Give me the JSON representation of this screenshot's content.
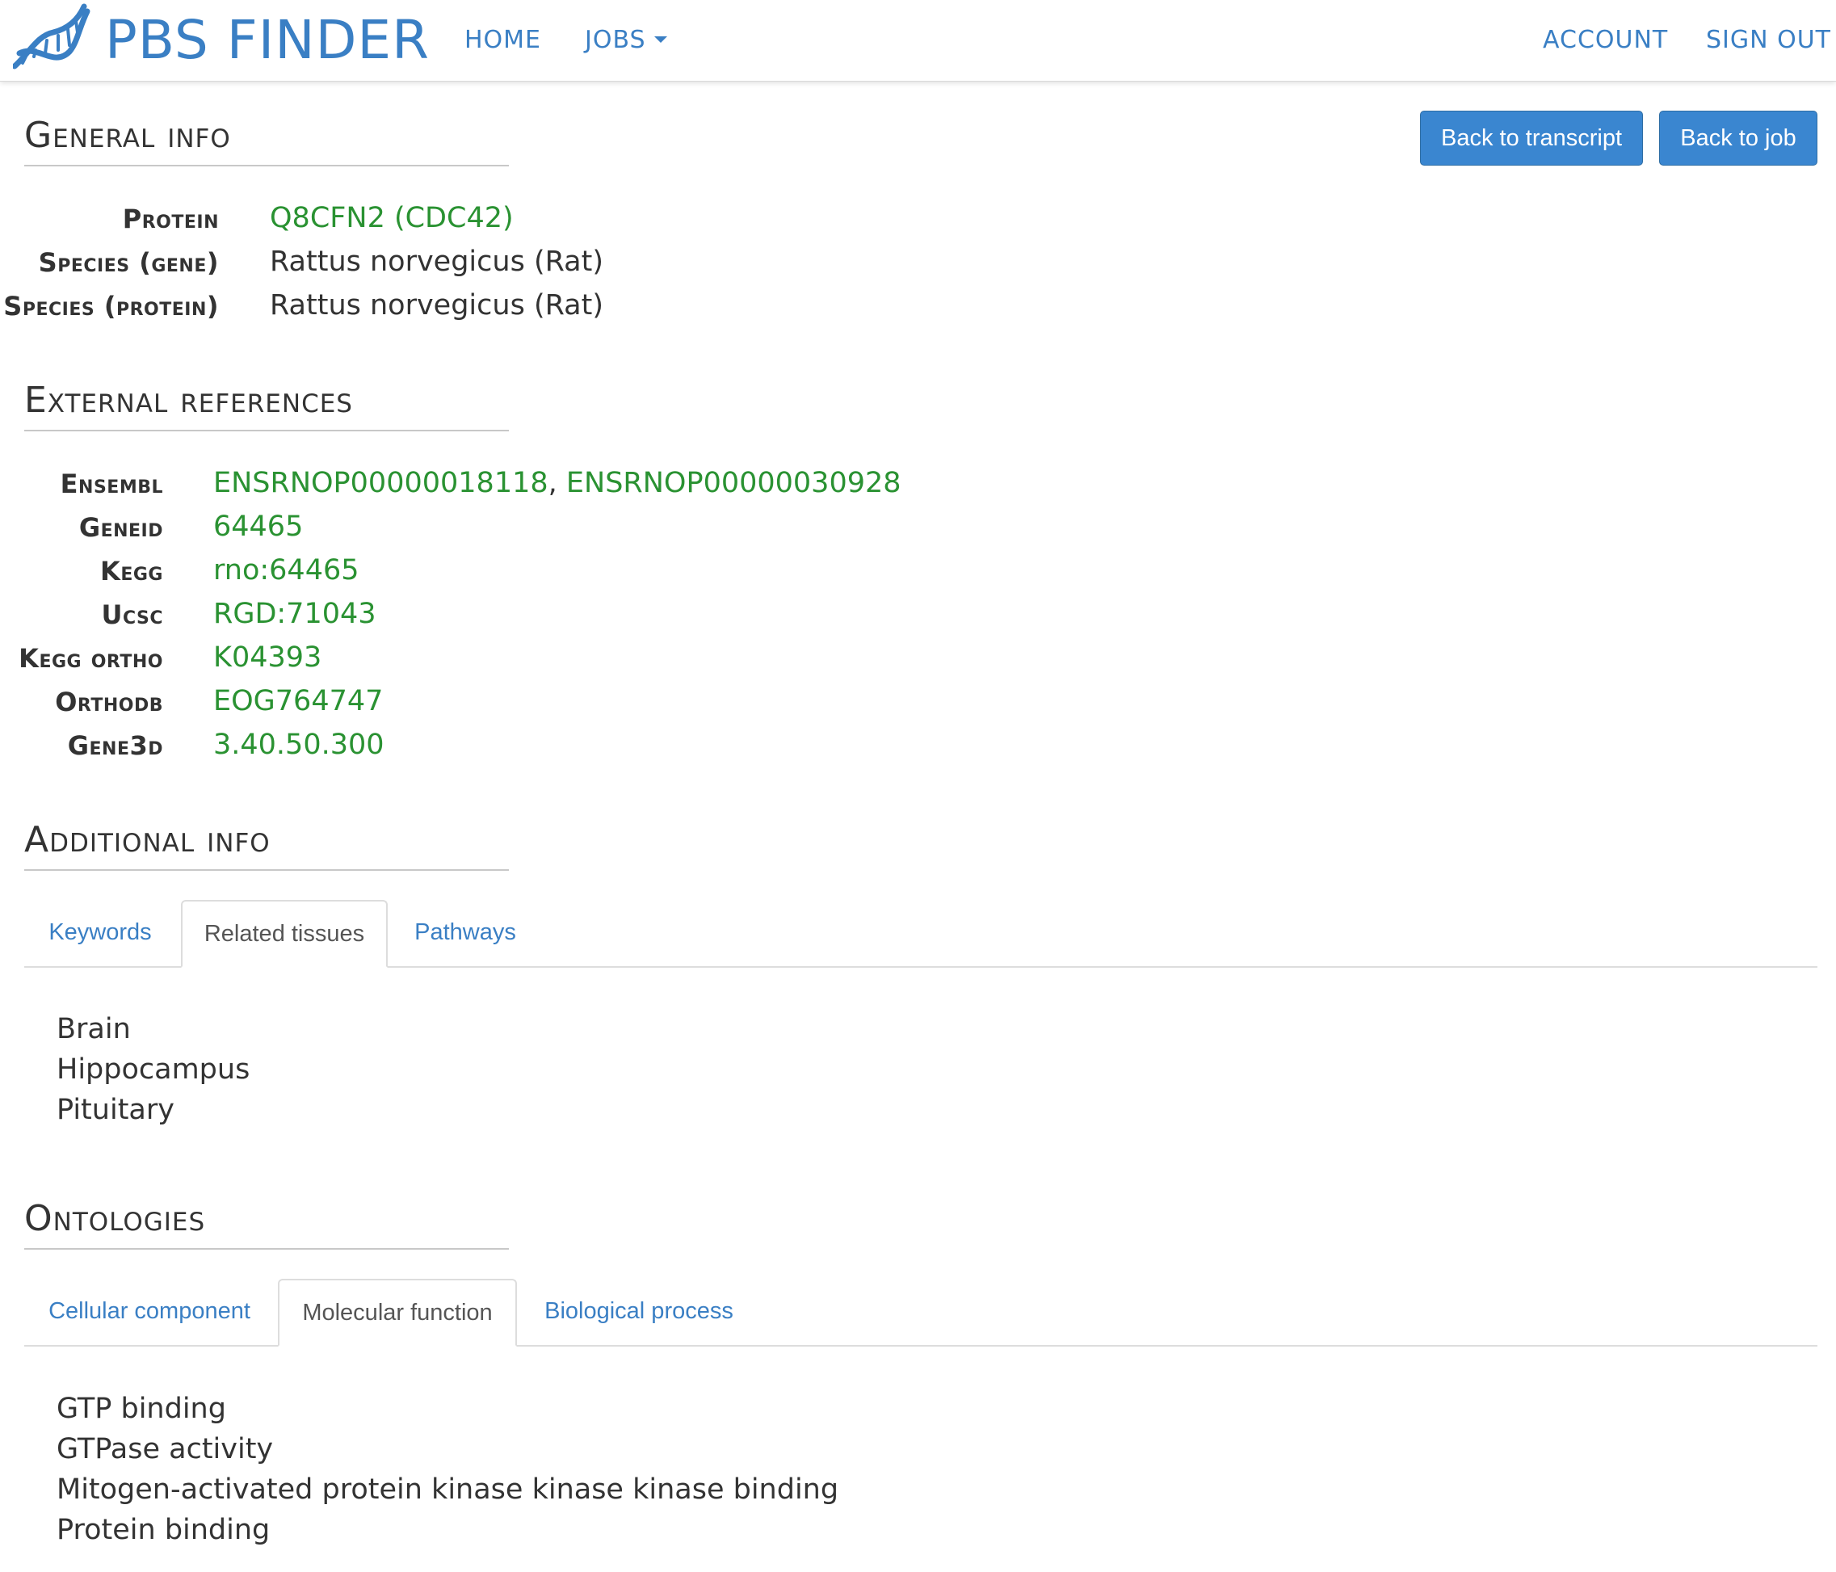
{
  "navbar": {
    "brand": "PBS FINDER",
    "links": {
      "home": "HOME",
      "jobs": "JOBS",
      "account": "ACCOUNT",
      "sign_out": "SIGN OUT"
    }
  },
  "actions": {
    "back_to_transcript": "Back to transcript",
    "back_to_job": "Back to job"
  },
  "general_info": {
    "title": "General info",
    "rows": [
      {
        "label": "Protein",
        "value": "Q8CFN2 (CDC42)"
      },
      {
        "label": "Species (gene)",
        "value": "Rattus norvegicus (Rat)"
      },
      {
        "label": "Species (protein)",
        "value": "Rattus norvegicus (Rat)"
      }
    ]
  },
  "external_references": {
    "title": "External references",
    "rows": [
      {
        "label": "Ensembl",
        "values": [
          "ENSRNOP00000018118",
          "ENSRNOP00000030928"
        ],
        "separator": ","
      },
      {
        "label": "Geneid",
        "value": "64465"
      },
      {
        "label": "Kegg",
        "value": "rno:64465"
      },
      {
        "label": "Ucsc",
        "value": "RGD:71043"
      },
      {
        "label": "Kegg ortho",
        "value": "K04393"
      },
      {
        "label": "Orthodb",
        "value": "EOG764747"
      },
      {
        "label": "Gene3d",
        "value": "3.40.50.300"
      }
    ]
  },
  "additional_info": {
    "title": "Additional info",
    "tabs": [
      {
        "label": "Keywords",
        "active": false
      },
      {
        "label": "Related tissues",
        "active": true
      },
      {
        "label": "Pathways",
        "active": false
      }
    ],
    "items": [
      "Brain",
      "Hippocampus",
      "Pituitary"
    ]
  },
  "ontologies": {
    "title": "Ontologies",
    "tabs": [
      {
        "label": "Cellular component",
        "active": false
      },
      {
        "label": "Molecular function",
        "active": true
      },
      {
        "label": "Biological process",
        "active": false
      }
    ],
    "items": [
      "GTP binding",
      "GTPase activity",
      "Mitogen-activated protein kinase kinase kinase binding",
      "Protein binding"
    ]
  },
  "colors": {
    "brand_blue": "#3a7fc4",
    "button_blue": "#3a86d0",
    "link_green": "#2a9232",
    "text": "#333333"
  },
  "icons": {
    "logo": "dna-helix-icon",
    "jobs_dropdown": "caret-down-icon"
  }
}
